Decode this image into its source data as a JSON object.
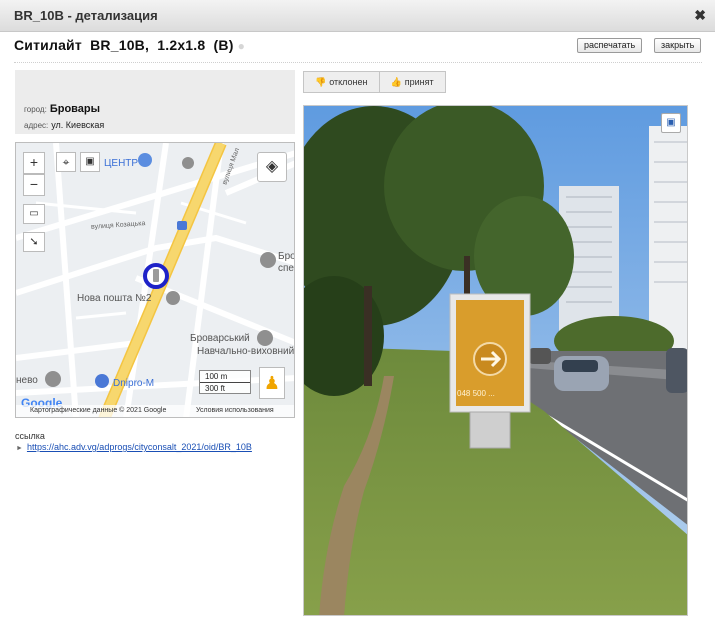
{
  "window": {
    "title": "BR_10B - детализация",
    "close_glyph": "✖"
  },
  "header": {
    "title": "Ситилайт  BR_10B,  1.2x1.8  (B)",
    "print_label": "распечатать",
    "close_label": "закрыть"
  },
  "info": {
    "city_label": "город:",
    "city_value": "Бровары",
    "address_label": "адрес:",
    "address_value": "ул. Киевская"
  },
  "map": {
    "labels": {
      "center": "ЦЕНТР",
      "street": "вулиця Козацька",
      "post": "Нова пошта №2",
      "school_1": "Броварський",
      "school_2": "Навчально-виховний...",
      "dnipro": "Dnipro-M",
      "left_edge": "нево",
      "street_vertical": "вулиця Мал",
      "right_1": "Бро",
      "right_2": "спе"
    },
    "scale_m": "100 m",
    "scale_ft": "300 ft",
    "attribution": "Картографические данные © 2021 Google",
    "terms": "Условия использования",
    "google_logo": "Google",
    "icons": [
      "zoom-in",
      "zoom-out",
      "ruler",
      "arrow",
      "locate",
      "save",
      "layers",
      "pegman"
    ]
  },
  "link": {
    "heading": "ссылка",
    "url": "https://ahc.adv.vg/adprogs/cityconsalt_2021/oid/BR_10B"
  },
  "status": {
    "rejected": "отклонен",
    "accepted": "принят"
  },
  "photo": {
    "billboard_phone": "048 500 ..."
  },
  "colors": {
    "road": "#f7d36a",
    "marker_ring": "#1e22c8",
    "link": "#1a4fb5"
  }
}
